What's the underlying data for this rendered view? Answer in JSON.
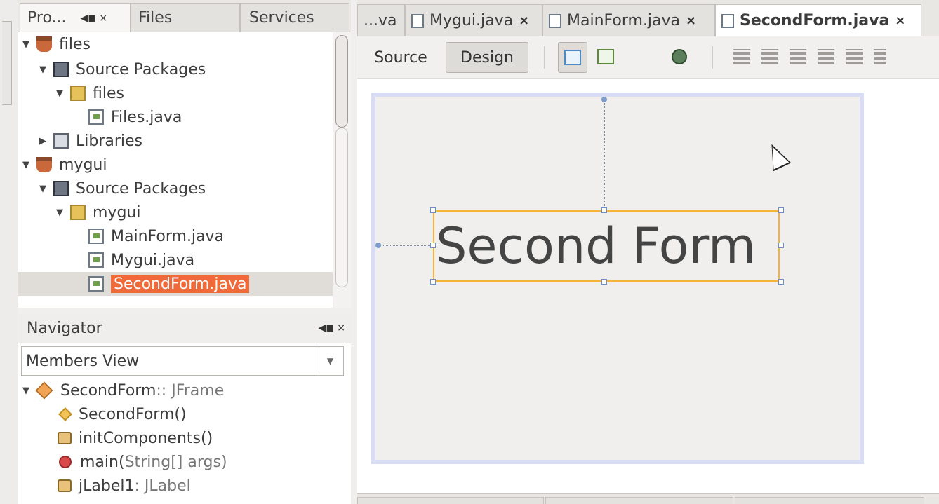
{
  "projects_panel": {
    "tabs": [
      {
        "label": "Pro..."
      },
      {
        "label": "Files"
      },
      {
        "label": "Services"
      }
    ],
    "tab_controls": "◀◼ ×",
    "tree": [
      {
        "label": "files"
      },
      {
        "label": "Source Packages"
      },
      {
        "label": "files"
      },
      {
        "label": "Files.java"
      },
      {
        "label": "Libraries"
      },
      {
        "label": "mygui"
      },
      {
        "label": "Source Packages"
      },
      {
        "label": "mygui"
      },
      {
        "label": "MainForm.java"
      },
      {
        "label": "Mygui.java"
      },
      {
        "label": "SecondForm.java"
      }
    ]
  },
  "navigator": {
    "title": "Navigator",
    "controls": "◀◼ ×",
    "view_select": "Members View",
    "members": [
      {
        "name": "SecondForm",
        "type": " :: JFrame"
      },
      {
        "name": "SecondForm()",
        "type": ""
      },
      {
        "name": "initComponents()",
        "type": ""
      },
      {
        "name": "main(",
        "type": "String[] args)"
      },
      {
        "name": "jLabel1",
        "type": " : JLabel"
      }
    ]
  },
  "editor": {
    "tabs": [
      {
        "label": "...va"
      },
      {
        "label": "Mygui.java"
      },
      {
        "label": "MainForm.java"
      },
      {
        "label": "SecondForm.java"
      }
    ],
    "close_glyph": "×",
    "source_label": "Source",
    "design_label": "Design",
    "form_label_text": "Second Form"
  },
  "colors": {
    "selection": "#f06a39",
    "canvas_border": "#d8dcf4",
    "component_border": "#f3b43a"
  }
}
